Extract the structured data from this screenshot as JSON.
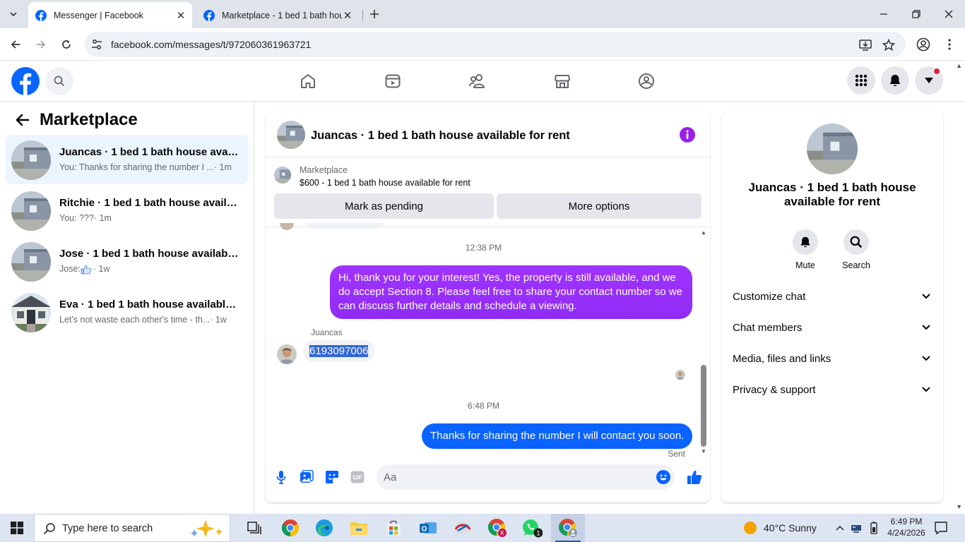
{
  "browser": {
    "tabs": [
      {
        "title": "Messenger | Facebook",
        "active": true
      },
      {
        "title": "Marketplace - 1 bed 1 bath hou",
        "active": false
      }
    ],
    "url": "facebook.com/messages/t/972060361963721"
  },
  "left_panel": {
    "title": "Marketplace",
    "conversations": [
      {
        "name": "Juancas · 1 bed 1 bath house availa...",
        "preview": "You: Thanks for sharing the number I ...",
        "time": "· 1m",
        "active": true
      },
      {
        "name": "Ritchie · 1 bed 1 bath house availa...",
        "preview": "You: ??? ",
        "time": "· 1m",
        "active": false
      },
      {
        "name": "Jose · 1 bed 1 bath house available ...",
        "preview": "Jose: ",
        "time": " · 1w",
        "active": false
      },
      {
        "name": "Eva · 1 bed 1 bath house available f...",
        "preview": "Let's not waste each other's time - th...",
        "time": " · 1w",
        "active": false
      }
    ]
  },
  "chat": {
    "title": "Juancas · 1 bed 1 bath house available for rent",
    "marketplace_label": "Marketplace",
    "listing": "$600 - 1 bed 1 bath house available for rent",
    "mark_pending": "Mark as pending",
    "more_options": "More options",
    "timestamp1": "12:38 PM",
    "outgoing1": "Hi, thank you for your interest! Yes, the property is still available, and we do accept Section 8. Please feel free to share your contact number so we can discuss further details and schedule a viewing.",
    "sender": "Juancas",
    "incoming1": "6193097006",
    "timestamp2": "6:48 PM",
    "outgoing2": "Thanks for sharing the number I will contact you soon.",
    "sent_status": "Sent",
    "composer_placeholder": "Aa",
    "accent_color": "#8a2be2",
    "bubble_gradient_top": "#a033ff",
    "bubble_blue": "#0a62ff"
  },
  "right_panel": {
    "name": "Juancas · 1 bed 1 bath house available for rent",
    "mute_label": "Mute",
    "search_label": "Search",
    "sections": [
      "Customize chat",
      "Chat members",
      "Media, files and links",
      "Privacy & support"
    ]
  },
  "taskbar": {
    "search_placeholder": "Type here to search",
    "weather": "40°C  Sunny",
    "time": "6:49 PM",
    "date": "4/24/2026",
    "whatsapp_badge": "1"
  }
}
